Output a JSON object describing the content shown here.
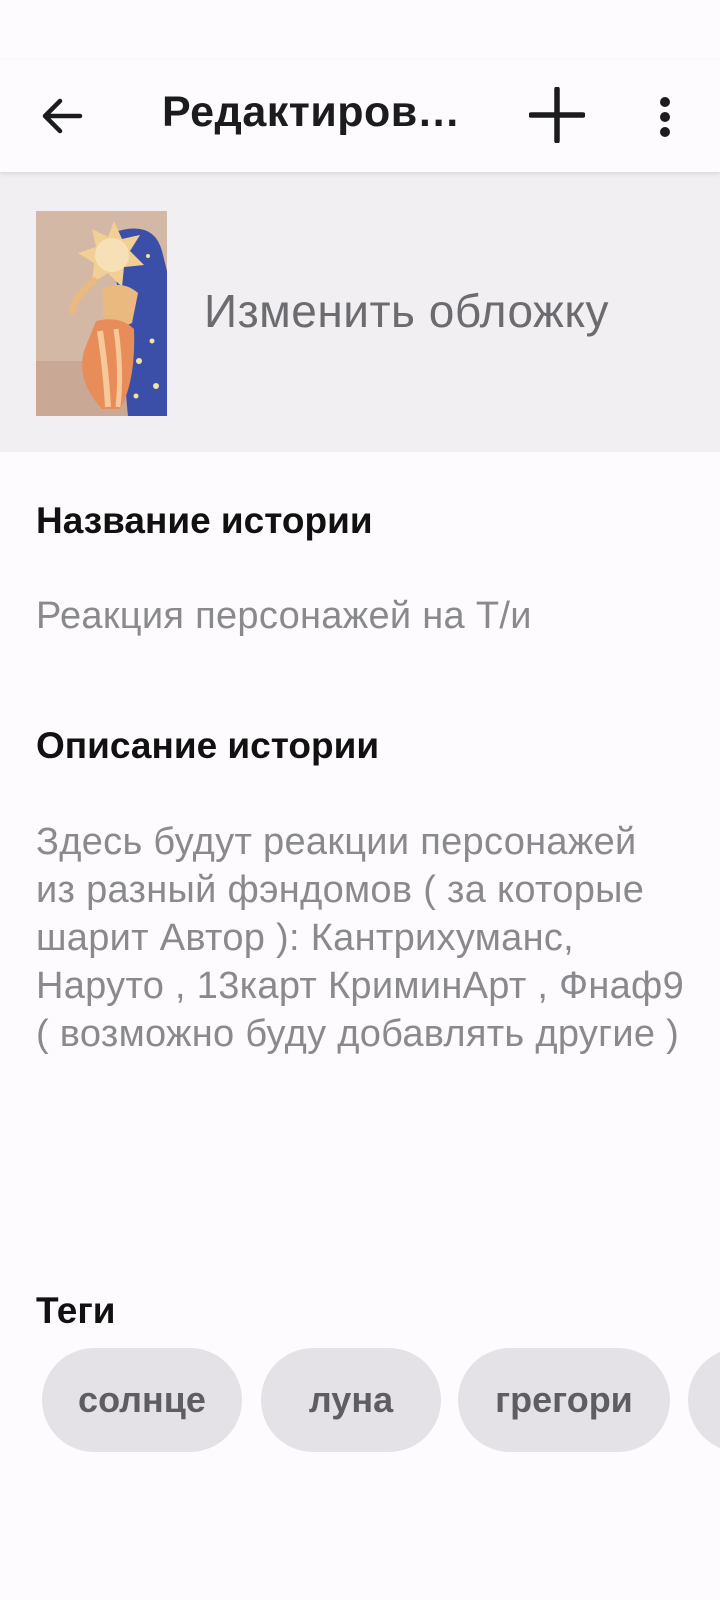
{
  "app_bar": {
    "title": "Редактирова...",
    "icons": {
      "back": "arrow-left-icon",
      "add": "plus-icon",
      "more": "more-vertical-icon"
    }
  },
  "cover": {
    "label": "Изменить обложку"
  },
  "story_title": {
    "label": "Название истории",
    "value": "Реакция персонажей на Т/и"
  },
  "story_description": {
    "label": "Описание истории",
    "value": "Здесь будут реакции персонажей из разный фэндомов ( за которые шарит Автор ): Кантрихуманс, Наруто , 13карт КриминАрт , Фнаф9 ( возможно буду добавлять другие )"
  },
  "tags": {
    "label": "Теги",
    "items": [
      "солнце",
      "луна",
      "грегори",
      ""
    ]
  },
  "colors": {
    "background": "#fdfbfd",
    "cover_section_bg": "#f1eff2",
    "tag_bg": "#e4e2e6",
    "secondary_text": "#8a8a8e"
  }
}
